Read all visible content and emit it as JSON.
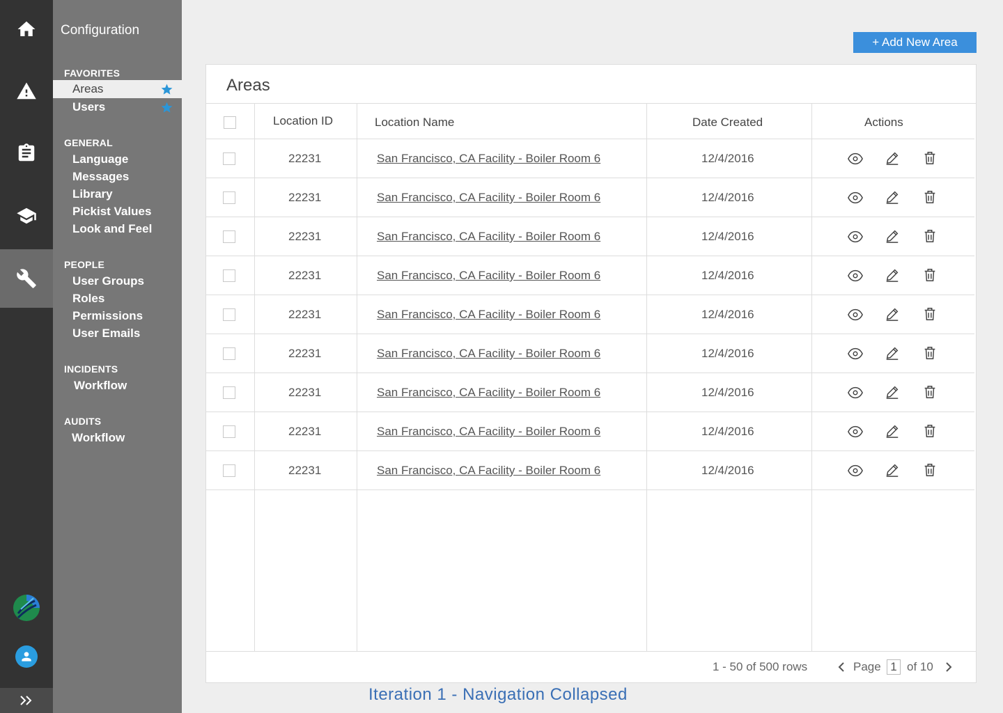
{
  "rail": {
    "items": [
      "home",
      "alerts",
      "clipboard",
      "training",
      "configuration"
    ],
    "active": "configuration"
  },
  "confnav": {
    "title": "Configuration",
    "groups": [
      {
        "label": "FAVORITES",
        "items": [
          "Areas",
          "Users"
        ]
      },
      {
        "label": "GENERAL",
        "items": [
          "Language",
          "Messages",
          "Library",
          "Pickist Values",
          "Look and Feel"
        ]
      },
      {
        "label": "PEOPLE",
        "items": [
          "User Groups",
          "Roles",
          "Permissions",
          "User Emails"
        ]
      },
      {
        "label": "INCIDENTS",
        "items": [
          "Workflow"
        ]
      },
      {
        "label": "AUDITS",
        "items": [
          "Workflow"
        ]
      }
    ],
    "selected": "Areas"
  },
  "toolbar": {
    "add_label": "+ Add New Area"
  },
  "card": {
    "title": "Areas",
    "columns": [
      "Location ID",
      "Location Name",
      "Date Created",
      "Actions"
    ],
    "rows": [
      {
        "id": "22231",
        "name": "San Francisco, CA Facility - Boiler Room 6",
        "date": "12/4/2016"
      },
      {
        "id": "22231",
        "name": "San Francisco, CA Facility - Boiler Room 6",
        "date": "12/4/2016"
      },
      {
        "id": "22231",
        "name": "San Francisco, CA Facility - Boiler Room 6",
        "date": "12/4/2016"
      },
      {
        "id": "22231",
        "name": "San Francisco, CA Facility - Boiler Room 6",
        "date": "12/4/2016"
      },
      {
        "id": "22231",
        "name": "San Francisco, CA Facility - Boiler Room 6",
        "date": "12/4/2016"
      },
      {
        "id": "22231",
        "name": "San Francisco, CA Facility - Boiler Room 6",
        "date": "12/4/2016"
      },
      {
        "id": "22231",
        "name": "San Francisco, CA Facility - Boiler Room 6",
        "date": "12/4/2016"
      },
      {
        "id": "22231",
        "name": "San Francisco, CA Facility - Boiler Room 6",
        "date": "12/4/2016"
      },
      {
        "id": "22231",
        "name": "San Francisco, CA Facility - Boiler Room 6",
        "date": "12/4/2016"
      }
    ]
  },
  "pagination": {
    "rows_text": "1 - 50 of 500 rows",
    "page_label": "Page",
    "page_value": "1",
    "of_text": "of 10"
  },
  "caption": "Iteration 1 - Navigation Collapsed",
  "colors": {
    "accent": "#3b8fdc",
    "star": "#2b96d8",
    "caption": "#3a6fb5"
  }
}
